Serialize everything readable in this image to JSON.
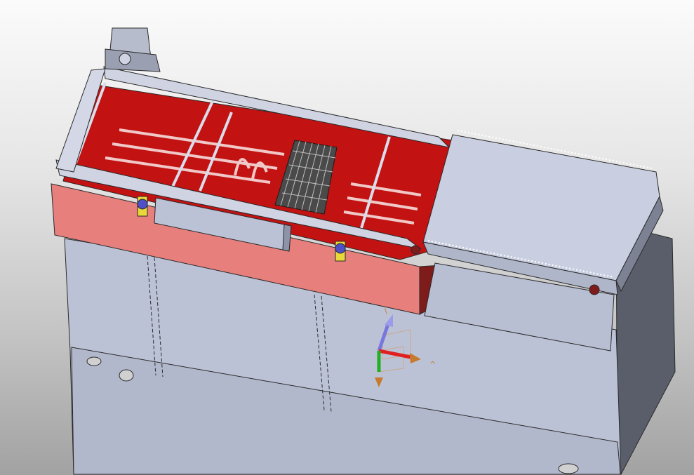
{
  "viewport": {
    "model": "fryer-conveyor-assembly",
    "render_mode": "shaded-with-edges",
    "background": "gray-gradient"
  },
  "triad": {
    "x_label": "^",
    "y_label": "",
    "z_label": "\\",
    "colors": {
      "x_axis": "#e02020",
      "y_axis": "#22b022",
      "z_axis": "#7777dd",
      "label": "#c77a2e"
    }
  },
  "colors": {
    "steel": "#bcc2d6",
    "steel_dark": "#8d93a8",
    "steel_side": "#6e7385",
    "oil_red": "#c21212",
    "tank_front": "#e77f7c",
    "tank_side": "#7d1c1a",
    "knob_blue": "#4f4fc8",
    "bracket_yellow": "#e8d83a",
    "edge": "#2a2a2a"
  }
}
